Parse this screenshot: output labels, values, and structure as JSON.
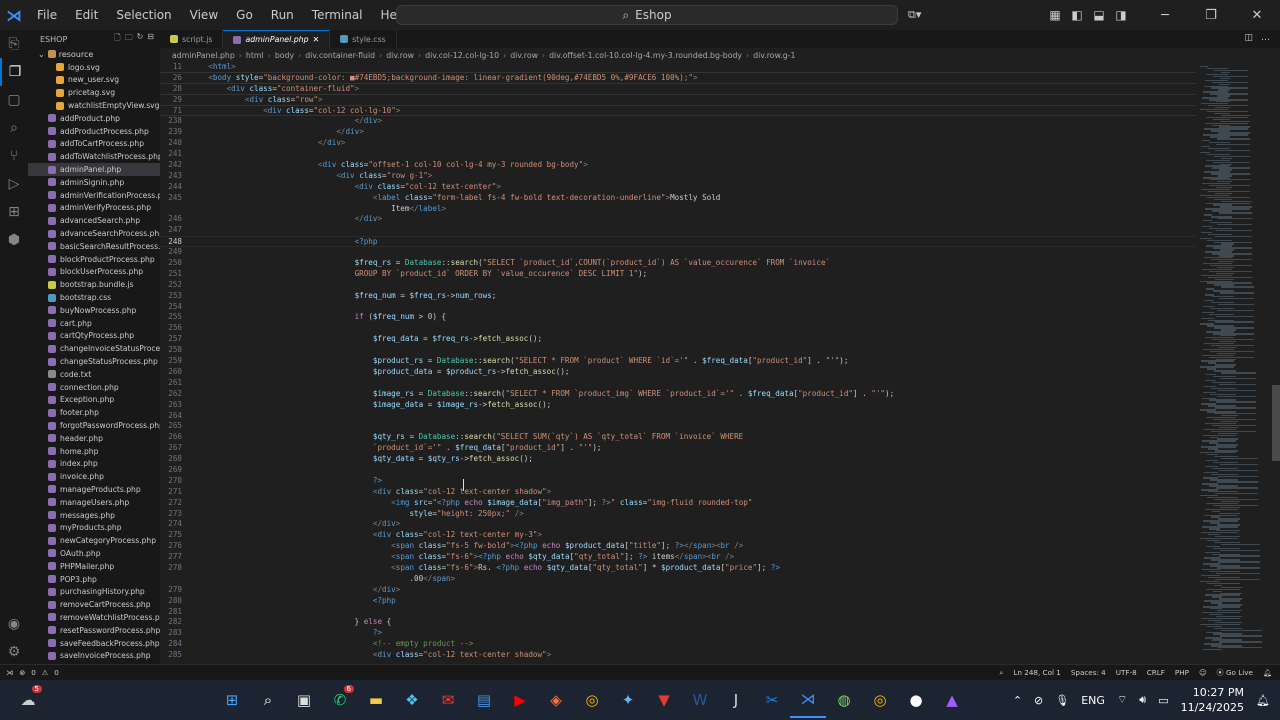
{
  "titlebar": {
    "menu": [
      "File",
      "Edit",
      "Selection",
      "View",
      "Go",
      "Run",
      "Terminal",
      "Help"
    ],
    "search_text": "Eshop"
  },
  "sidebar": {
    "title": "ESHOP",
    "root_folder": "resource",
    "files": [
      {
        "name": "logo.svg",
        "type": "svg",
        "indent": 1
      },
      {
        "name": "new_user.svg",
        "type": "svg",
        "indent": 1
      },
      {
        "name": "pricetag.svg",
        "type": "svg",
        "indent": 1
      },
      {
        "name": "watchlistEmptyView.svg",
        "type": "svg",
        "indent": 1
      },
      {
        "name": "addProduct.php",
        "type": "php",
        "indent": 0
      },
      {
        "name": "addProductProcess.php",
        "type": "php",
        "indent": 0
      },
      {
        "name": "addToCartProcess.php",
        "type": "php",
        "indent": 0
      },
      {
        "name": "addToWatchlistProcess.php",
        "type": "php",
        "indent": 0
      },
      {
        "name": "adminPanel.php",
        "type": "php",
        "indent": 0,
        "active": true
      },
      {
        "name": "adminSignin.php",
        "type": "php",
        "indent": 0
      },
      {
        "name": "adminVerificationProcess.php",
        "type": "php",
        "indent": 0
      },
      {
        "name": "adminVerifyProcess.php",
        "type": "php",
        "indent": 0
      },
      {
        "name": "advancedSearch.php",
        "type": "php",
        "indent": 0
      },
      {
        "name": "advanceSearchProcess.php",
        "type": "php",
        "indent": 0
      },
      {
        "name": "basicSearchResultProcess.php",
        "type": "php",
        "indent": 0
      },
      {
        "name": "blockProductProcess.php",
        "type": "php",
        "indent": 0
      },
      {
        "name": "blockUserProcess.php",
        "type": "php",
        "indent": 0
      },
      {
        "name": "bootstrap.bundle.js",
        "type": "js",
        "indent": 0
      },
      {
        "name": "bootstrap.css",
        "type": "css",
        "indent": 0
      },
      {
        "name": "buyNowProcess.php",
        "type": "php",
        "indent": 0
      },
      {
        "name": "cart.php",
        "type": "php",
        "indent": 0
      },
      {
        "name": "cartQtyProcess.php",
        "type": "php",
        "indent": 0
      },
      {
        "name": "changeInvoiceStatusProcess...",
        "type": "php",
        "indent": 0
      },
      {
        "name": "changeStatusProcess.php",
        "type": "php",
        "indent": 0
      },
      {
        "name": "code.txt",
        "type": "txt",
        "indent": 0
      },
      {
        "name": "connection.php",
        "type": "php",
        "indent": 0
      },
      {
        "name": "Exception.php",
        "type": "php",
        "indent": 0
      },
      {
        "name": "footer.php",
        "type": "php",
        "indent": 0
      },
      {
        "name": "forgotPasswordProcess.php",
        "type": "php",
        "indent": 0
      },
      {
        "name": "header.php",
        "type": "php",
        "indent": 0
      },
      {
        "name": "home.php",
        "type": "php",
        "indent": 0
      },
      {
        "name": "index.php",
        "type": "php",
        "indent": 0
      },
      {
        "name": "invoice.php",
        "type": "php",
        "indent": 0
      },
      {
        "name": "manageProducts.php",
        "type": "php",
        "indent": 0
      },
      {
        "name": "manageUsers.php",
        "type": "php",
        "indent": 0
      },
      {
        "name": "messages.php",
        "type": "php",
        "indent": 0
      },
      {
        "name": "myProducts.php",
        "type": "php",
        "indent": 0
      },
      {
        "name": "newCategoryProcess.php",
        "type": "php",
        "indent": 0
      },
      {
        "name": "OAuth.php",
        "type": "php",
        "indent": 0
      },
      {
        "name": "PHPMailer.php",
        "type": "php",
        "indent": 0
      },
      {
        "name": "POP3.php",
        "type": "php",
        "indent": 0
      },
      {
        "name": "purchasingHistory.php",
        "type": "php",
        "indent": 0
      },
      {
        "name": "removeCartProcess.php",
        "type": "php",
        "indent": 0
      },
      {
        "name": "removeWatchlistProcess.php",
        "type": "php",
        "indent": 0
      },
      {
        "name": "resetPasswordProcess.php",
        "type": "php",
        "indent": 0
      },
      {
        "name": "saveFeedbackProcess.php",
        "type": "php",
        "indent": 0
      },
      {
        "name": "saveInvoiceProcess.php",
        "type": "php",
        "indent": 0
      }
    ]
  },
  "tabs": [
    {
      "name": "script.js",
      "type": "js",
      "active": false
    },
    {
      "name": "adminPanel.php",
      "type": "php",
      "active": true
    },
    {
      "name": "style.css",
      "type": "css",
      "active": false
    }
  ],
  "breadcrumb": [
    "adminPanel.php",
    "html",
    "body",
    "div.container-fluid",
    "div.row",
    "div.col-12.col-lg-10",
    "div.row",
    "div.offset-1.col-10.col-lg-4.my-3.rounded.bg-body",
    "div.row.g-1"
  ],
  "editor": {
    "current_line": "248",
    "lines": [
      {
        "n": "11",
        "sticky": true,
        "html": "    <span class='g'>&lt;</span><span class='t'>html</span><span class='g'>&gt;</span>"
      },
      {
        "n": "26",
        "sticky": true,
        "html": "    <span class='g'>&lt;</span><span class='t'>body</span> <span class='a'>style</span>=<span class='s'>\"background-color: ■#74EBD5;background-image: linear-gradient(90deg,#74EBD5 0%,#9FACE6 100%);\"</span><span class='g'>&gt;</span>"
      },
      {
        "n": "28",
        "sticky": true,
        "html": "        <span class='g'>&lt;</span><span class='t'>div</span> <span class='a'>class</span>=<span class='s'>\"container-fluid\"</span><span class='g'>&gt;</span>"
      },
      {
        "n": "29",
        "sticky": true,
        "html": "            <span class='g'>&lt;</span><span class='t'>div</span> <span class='a'>class</span>=<span class='s'>\"row\"</span><span class='g'>&gt;</span>"
      },
      {
        "n": "71",
        "sticky": true,
        "html": "                <span class='g'>&lt;</span><span class='t'>div</span> <span class='a'>class</span>=<span class='s'>\"col-12 col-lg-10\"</span><span class='g'>&gt;</span>"
      },
      {
        "n": "238",
        "html": "                                    <span class='g'>&lt;/</span><span class='t'>div</span><span class='g'>&gt;</span>"
      },
      {
        "n": "239",
        "html": "                                <span class='g'>&lt;/</span><span class='t'>div</span><span class='g'>&gt;</span>"
      },
      {
        "n": "240",
        "html": "                            <span class='g'>&lt;/</span><span class='t'>div</span><span class='g'>&gt;</span>"
      },
      {
        "n": "241",
        "html": ""
      },
      {
        "n": "242",
        "html": "                            <span class='g'>&lt;</span><span class='t'>div</span> <span class='a'>class</span>=<span class='s'>\"offset-1 col-10 col-lg-4 my-3 rounded bg-body\"</span><span class='g'>&gt;</span>"
      },
      {
        "n": "243",
        "html": "                                <span class='g'>&lt;</span><span class='t'>div</span> <span class='a'>class</span>=<span class='s'>\"row g-1\"</span><span class='g'>&gt;</span>"
      },
      {
        "n": "244",
        "html": "                                    <span class='g'>&lt;</span><span class='t'>div</span> <span class='a'>class</span>=<span class='s'>\"col-12 text-center\"</span><span class='g'>&gt;</span>"
      },
      {
        "n": "245",
        "html": "                                        <span class='g'>&lt;</span><span class='t'>label</span> <span class='a'>class</span>=<span class='s'>\"form-label fs-4 fw-bold text-decoration-underline\"</span><span class='g'>&gt;</span>Mostly Sold"
      },
      {
        "n": "",
        "html": "                                            Item<span class='g'>&lt;/</span><span class='t'>label</span><span class='g'>&gt;</span>"
      },
      {
        "n": "246",
        "html": "                                    <span class='g'>&lt;/</span><span class='t'>div</span><span class='g'>&gt;</span>"
      },
      {
        "n": "247",
        "html": ""
      },
      {
        "n": "248",
        "html": "                                    <span class='p'>&lt;?php</span>",
        "cur": true
      },
      {
        "n": "249",
        "html": ""
      },
      {
        "n": "250",
        "html": "                                    <span class='v'>$freq_rs</span> = <span class='cl'>Database</span>::<span class='f'>search</span>(<span class='s'>\"SELECT `product_id`,COUNT(`product_id`) AS `value_occurence` FROM `invoice`</span>"
      },
      {
        "n": "251",
        "html": "                                    <span class='s'>GROUP BY `product_id` ORDER BY `value_occurence` DESC LIMIT 1\"</span>);"
      },
      {
        "n": "252",
        "html": ""
      },
      {
        "n": "253",
        "html": "                                    <span class='v'>$freq_num</span> = <span class='v'>$freq_rs</span>-&gt;<span class='v'>num_rows</span>;"
      },
      {
        "n": "254",
        "html": ""
      },
      {
        "n": "255",
        "html": "                                    <span class='k'>if</span> (<span class='v'>$freq_num</span> &gt; <span class='n'>0</span>) {"
      },
      {
        "n": "256",
        "html": ""
      },
      {
        "n": "257",
        "html": "                                        <span class='v'>$freq_data</span> = <span class='v'>$freq_rs</span>-&gt;<span class='f'>fetch_assoc</span>();"
      },
      {
        "n": "258",
        "html": ""
      },
      {
        "n": "259",
        "html": "                                        <span class='v'>$product_rs</span> = <span class='cl'>Database</span>::<span class='f'>search</span>(<span class='s'>\"SELECT * FROM `product` WHERE `id`='\"</span> . <span class='v'>$freq_data</span>[<span class='s'>\"product_id\"</span>] . <span class='s'>\"'\"</span>);"
      },
      {
        "n": "260",
        "html": "                                        <span class='v'>$product_data</span> = <span class='v'>$product_rs</span>-&gt;<span class='f'>fetch_assoc</span>();"
      },
      {
        "n": "261",
        "html": ""
      },
      {
        "n": "262",
        "html": "                                        <span class='v'>$image_rs</span> = <span class='cl'>Database</span>::<span class='f'>search</span>(<span class='s'>\"SELECT * FROM `product_img` WHERE `product_id`='\"</span> . <span class='v'>$freq_data</span>[<span class='s'>\"product_id\"</span>] . <span class='s'>\"'\"</span>);"
      },
      {
        "n": "263",
        "html": "                                        <span class='v'>$image_data</span> = <span class='v'>$image_rs</span>-&gt;<span class='f'>fetch_assoc</span>();"
      },
      {
        "n": "264",
        "html": ""
      },
      {
        "n": "265",
        "html": ""
      },
      {
        "n": "266",
        "html": "                                        <span class='v'>$qty_rs</span> = <span class='cl'>Database</span>::<span class='f'>search</span>(<span class='s'>\"SELECT SUM(`qty`) AS `qty_total` FROM `invoice` WHERE</span>"
      },
      {
        "n": "267",
        "html": "                                        <span class='s'>`product_id`='\"</span> . <span class='v'>$freq_data</span>[<span class='s'>\"product_id\"</span>] . <span class='s'>\"'\"</span>);"
      },
      {
        "n": "268",
        "html": "                                        <span class='v'>$qty_data</span> = <span class='v'>$qty_rs</span>-&gt;<span class='f'>fetch_assoc</span>();"
      },
      {
        "n": "269",
        "html": ""
      },
      {
        "n": "270",
        "html": "                                        <span class='p'>?&gt;</span>"
      },
      {
        "n": "271",
        "html": "                                        <span class='g'>&lt;</span><span class='t'>div</span> <span class='a'>class</span>=<span class='s'>\"col-12 text-center shadow\"</span><span class='g'>&gt;</span>"
      },
      {
        "n": "272",
        "html": "                                            <span class='g'>&lt;</span><span class='t'>img</span> <span class='a'>src</span>=<span class='s'>\"</span><span class='p'>&lt;?php</span> <span class='k'>echo</span> <span class='v'>$image_data</span>[<span class='s'>\"img_path\"</span>]; <span class='p'>?&gt;</span><span class='s'>\"</span> <span class='a'>class</span>=<span class='s'>\"img-fluid rounded-top\"</span>"
      },
      {
        "n": "273",
        "html": "                                                <span class='a'>style</span>=<span class='s'>\"height: 250px;\"</span> <span class='g'>/&gt;</span>"
      },
      {
        "n": "274",
        "html": "                                        <span class='g'>&lt;/</span><span class='t'>div</span><span class='g'>&gt;</span>"
      },
      {
        "n": "275",
        "html": "                                        <span class='g'>&lt;</span><span class='t'>div</span> <span class='a'>class</span>=<span class='s'>\"col-12 text-center my-3\"</span><span class='g'>&gt;</span>"
      },
      {
        "n": "276",
        "html": "                                            <span class='g'>&lt;</span><span class='t'>span</span> <span class='a'>class</span>=<span class='s'>\"fs-5 fw-bold\"</span><span class='g'>&gt;</span><span class='p'>&lt;?php</span> <span class='k'>echo</span> <span class='v'>$product_data</span>[<span class='s'>\"title\"</span>]; <span class='p'>?&gt;</span><span class='g'>&lt;/</span><span class='t'>span</span><span class='g'>&gt;&lt;</span><span class='t'>br</span> <span class='g'>/&gt;</span>"
      },
      {
        "n": "277",
        "html": "                                            <span class='g'>&lt;</span><span class='t'>span</span> <span class='a'>class</span>=<span class='s'>\"fs-6\"</span><span class='g'>&gt;</span><span class='p'>&lt;?php</span> <span class='k'>echo</span> <span class='v'>$qty_data</span>[<span class='s'>\"qty_total\"</span>]; <span class='p'>?&gt;</span> items<span class='g'>&lt;/</span><span class='t'>span</span><span class='g'>&gt;&lt;</span><span class='t'>br</span> <span class='g'>/&gt;</span>"
      },
      {
        "n": "278",
        "html": "                                            <span class='g'>&lt;</span><span class='t'>span</span> <span class='a'>class</span>=<span class='s'>\"fs-6\"</span><span class='g'>&gt;</span>Rs. <span class='p'>&lt;?php</span> <span class='k'>echo</span> <span class='v'>$qty_data</span>[<span class='s'>\"qty_total\"</span>] * <span class='v'>$product_data</span>[<span class='s'>\"price\"</span>]; <span class='p'>?&gt;</span>"
      },
      {
        "n": "",
        "html": "                                                .00<span class='g'>&lt;/</span><span class='t'>span</span><span class='g'>&gt;</span>"
      },
      {
        "n": "279",
        "html": "                                        <span class='g'>&lt;/</span><span class='t'>div</span><span class='g'>&gt;</span>"
      },
      {
        "n": "280",
        "html": "                                        <span class='p'>&lt;?php</span>"
      },
      {
        "n": "281",
        "html": ""
      },
      {
        "n": "282",
        "html": "                                    } <span class='k'>else</span> {"
      },
      {
        "n": "283",
        "html": "                                        <span class='p'>?&gt;</span>"
      },
      {
        "n": "284",
        "html": "                                        <span class='c'>&lt;!-- empty product --&gt;</span>"
      },
      {
        "n": "285",
        "html": "                                        <span class='g'>&lt;</span><span class='t'>div</span> <span class='a'>class</span>=<span class='s'>\"col-12 text-center shadow\"</span><span class='g'>&gt;</span>"
      }
    ]
  },
  "statusbar": {
    "errors": "0",
    "warnings": "0",
    "position": "Ln 248, Col 1",
    "spaces": "Spaces: 4",
    "encoding": "UTF-8",
    "eol": "CRLF",
    "language": "PHP",
    "golive": "Go Live"
  },
  "taskbar": {
    "badge_weather": "5",
    "badge_whatsapp": "6",
    "lang": "ENG",
    "time": "10:27 PM",
    "date": "11/24/2025"
  }
}
